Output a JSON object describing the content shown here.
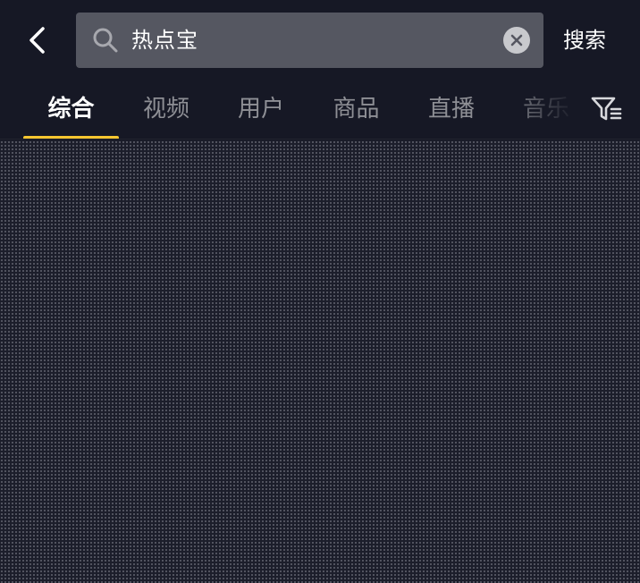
{
  "header": {
    "back_icon": "chevron-left-icon",
    "search": {
      "icon": "search-icon",
      "value": "热点宝",
      "clear_icon": "clear-icon"
    },
    "search_button_label": "搜索"
  },
  "tabs": {
    "items": [
      {
        "label": "综合",
        "active": true
      },
      {
        "label": "视频",
        "active": false
      },
      {
        "label": "用户",
        "active": false
      },
      {
        "label": "商品",
        "active": false
      },
      {
        "label": "直播",
        "active": false
      },
      {
        "label": "音乐",
        "active": false
      }
    ],
    "filter_icon": "filter-icon",
    "indicator_color": "#f6c630"
  },
  "colors": {
    "background": "#161825",
    "search_box": "#555761",
    "inactive_tab": "#8e8f95",
    "accent": "#f6c630"
  }
}
